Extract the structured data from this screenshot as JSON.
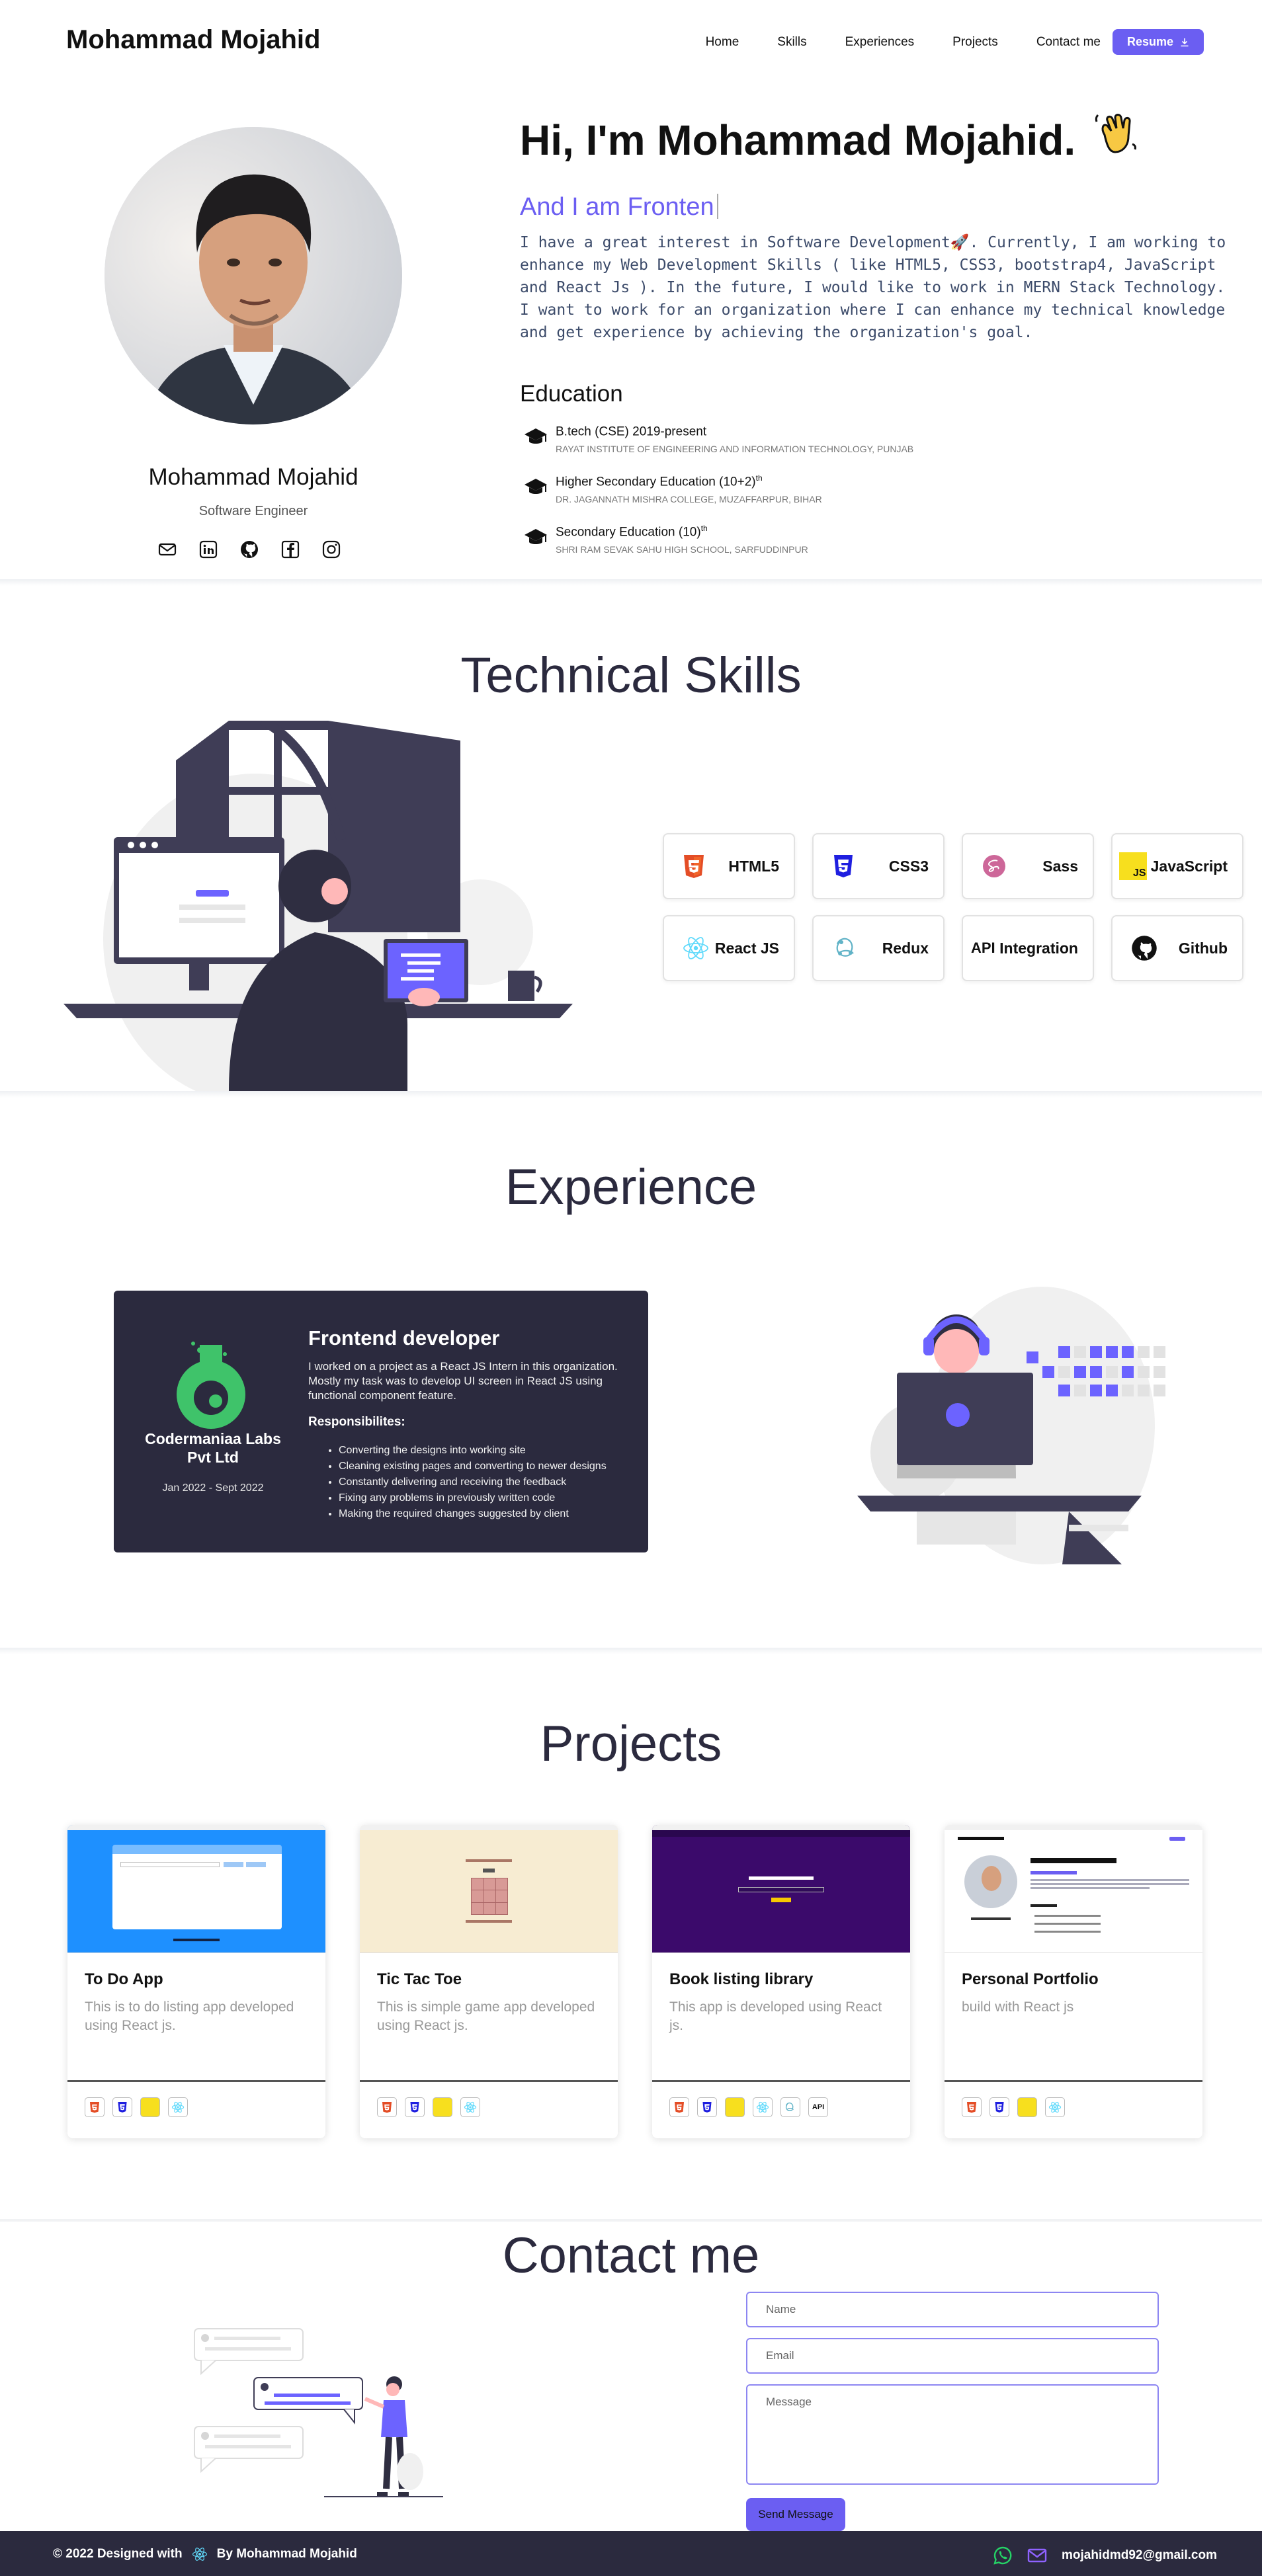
{
  "nav": {
    "brand": "Mohammad Mojahid",
    "links": [
      "Home",
      "Skills",
      "Experiences",
      "Projects",
      "Contact me"
    ],
    "resume_label": "Resume"
  },
  "hero": {
    "name": "Mohammad Mojahid",
    "role": "Software Engineer",
    "greeting": "Hi, I'm Mohammad Mojahid.",
    "typed_text": "And I am Fronten",
    "about": "I have a great interest in Software Development🚀. Currently, I am working to enhance my Web Development Skills ( like HTML5, CSS3, bootstrap4, JavaScript and React Js ). In the future, I would like to work in MERN Stack Technology. I want to work for an organization where I can enhance my technical knowledge and get experience by achieving the organization's goal.",
    "social_icons": [
      "mail-icon",
      "linkedin-icon",
      "github-icon",
      "facebook-icon",
      "instagram-icon"
    ]
  },
  "education": {
    "title": "Education",
    "items": [
      {
        "degree": "B.tech (CSE) 2019-present",
        "sup": "",
        "school": "RAYAT INSTITUTE OF ENGINEERING AND INFORMATION TECHNOLOGY, PUNJAB"
      },
      {
        "degree": "Higher Secondary Education (10+2)",
        "sup": "th",
        "school": "DR. JAGANNATH MISHRA COLLEGE, MUZAFFARPUR, BIHAR"
      },
      {
        "degree": "Secondary Education (10)",
        "sup": "th",
        "school": "SHRI RAM SEVAK SAHU HIGH SCHOOL, SARFUDDINPUR"
      }
    ]
  },
  "skills": {
    "title": "Technical Skills",
    "items": [
      {
        "label": "HTML5",
        "icon": "html5-icon",
        "color": "#e44d26"
      },
      {
        "label": "CSS3",
        "icon": "css3-icon",
        "color": "#1f1fe0"
      },
      {
        "label": "Sass",
        "icon": "sass-icon",
        "color": "#cd6799"
      },
      {
        "label": "JavaScript",
        "icon": "javascript-icon",
        "color": "#f7df1e"
      },
      {
        "label": "React JS",
        "icon": "react-icon",
        "color": "#61dafb"
      },
      {
        "label": "Redux",
        "icon": "redux-icon",
        "color": "#61b3c7"
      },
      {
        "label": "Integration",
        "icon": "api-icon",
        "badge": "API"
      },
      {
        "label": "Github",
        "icon": "github-icon",
        "color": "#111111"
      }
    ]
  },
  "experience": {
    "title": "Experience",
    "company": "Codermaniaa Labs Pvt Ltd",
    "date": "Jan 2022 - Sept 2022",
    "role": "Frontend developer",
    "description": "I worked on a project as a React JS Intern in this organization. Mostly my task was to develop UI screen in React JS using functional component feature.",
    "resp_title": "Responsibilites:",
    "responsibilities": [
      "Converting the designs into working site",
      "Cleaning existing pages and converting to newer designs",
      "Constantly delivering and receiving the feedback",
      "Fixing any problems in previously written code",
      "Making the required changes suggested by client"
    ]
  },
  "projects": {
    "title": "Projects",
    "items": [
      {
        "title": "To Do App",
        "desc": "This is to do listing app developed using React js.",
        "tech": [
          "html5",
          "css3",
          "javascript",
          "react"
        ]
      },
      {
        "title": "Tic Tac Toe",
        "desc": "This is simple game app developed using React js.",
        "tech": [
          "html5",
          "css3",
          "javascript",
          "react"
        ]
      },
      {
        "title": "Book listing library",
        "desc": "This app is developed using React js.",
        "tech": [
          "html5",
          "css3",
          "javascript",
          "react",
          "redux",
          "api"
        ]
      },
      {
        "title": "Personal Portfolio",
        "desc": "build with React js",
        "tech": [
          "html5",
          "css3",
          "javascript",
          "react"
        ]
      }
    ]
  },
  "contact": {
    "title": "Contact me",
    "name_placeholder": "Name",
    "email_placeholder": "Email",
    "message_placeholder": "Message",
    "send_label": "Send Message"
  },
  "footer": {
    "left_text": "© 2022 Designed with",
    "by_text": "By Mohammad Mojahid",
    "email": "mojahidmd92@gmail.com"
  },
  "colors": {
    "accent": "#6b5ef2",
    "dark": "#2b2a3e"
  }
}
